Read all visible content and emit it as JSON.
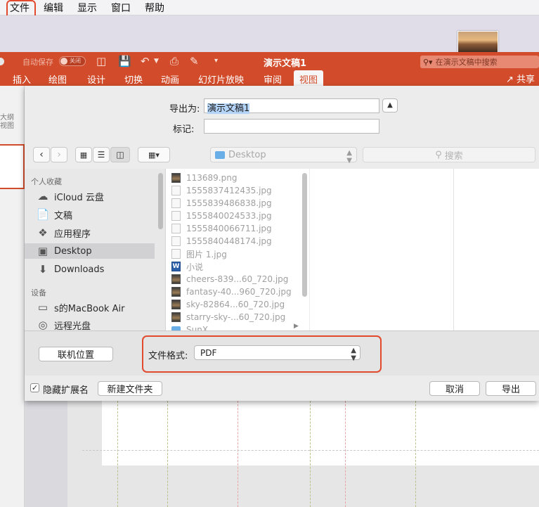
{
  "menubar": {
    "items": [
      "文件",
      "编辑",
      "显示",
      "窗口",
      "帮助"
    ]
  },
  "titlebar": {
    "autosave_label": "自动保存",
    "autosave_state": "关闭",
    "doc_title": "演示文稿1",
    "search_placeholder": "在演示文稿中搜索"
  },
  "ribbon": {
    "tabs": [
      "插入",
      "绘图",
      "设计",
      "切换",
      "动画",
      "幻灯片放映",
      "审阅",
      "视图"
    ],
    "active_tab": "视图",
    "share_label": "共享"
  },
  "left_panel": {
    "outline_label": "大纲视图"
  },
  "dialog": {
    "export_as_label": "导出为:",
    "export_as_value": "演示文稿1",
    "tags_label": "标记:",
    "tags_value": "",
    "location": "Desktop",
    "search_placeholder": "搜索",
    "sidebar": {
      "favorites_heading": "个人收藏",
      "favorites": [
        {
          "label": "iCloud 云盘",
          "icon": "cloud-icon"
        },
        {
          "label": "文稿",
          "icon": "document-icon"
        },
        {
          "label": "应用程序",
          "icon": "applications-icon"
        },
        {
          "label": "Desktop",
          "icon": "desktop-icon"
        },
        {
          "label": "Downloads",
          "icon": "downloads-icon"
        }
      ],
      "devices_heading": "设备",
      "devices": [
        {
          "label": "s的MacBook Air",
          "icon": "laptop-icon"
        },
        {
          "label": "远程光盘",
          "icon": "disc-icon"
        }
      ]
    },
    "files": [
      {
        "name": "113689.png",
        "kind": "img"
      },
      {
        "name": "1555837412435.jpg",
        "kind": "doc"
      },
      {
        "name": "1555839486838.jpg",
        "kind": "doc"
      },
      {
        "name": "1555840024533.jpg",
        "kind": "doc"
      },
      {
        "name": "1555840066711.jpg",
        "kind": "doc"
      },
      {
        "name": "1555840448174.jpg",
        "kind": "doc"
      },
      {
        "name": "图片 1.jpg",
        "kind": "doc"
      },
      {
        "name": "小说",
        "kind": "word"
      },
      {
        "name": "cheers-839...60_720.jpg",
        "kind": "img"
      },
      {
        "name": "fantasy-40...960_720.jpg",
        "kind": "img"
      },
      {
        "name": "sky-82864...60_720.jpg",
        "kind": "img"
      },
      {
        "name": "starry-sky-...60_720.jpg",
        "kind": "img"
      },
      {
        "name": "SunX",
        "kind": "folder"
      }
    ],
    "online_locations_label": "联机位置",
    "format_label": "文件格式:",
    "format_value": "PDF",
    "hide_extension_label": "隐藏扩展名",
    "hide_extension_checked": true,
    "new_folder_label": "新建文件夹",
    "cancel_label": "取消",
    "export_label": "导出"
  },
  "colors": {
    "accent": "#d24c2b",
    "highlight": "#e24a2e"
  }
}
